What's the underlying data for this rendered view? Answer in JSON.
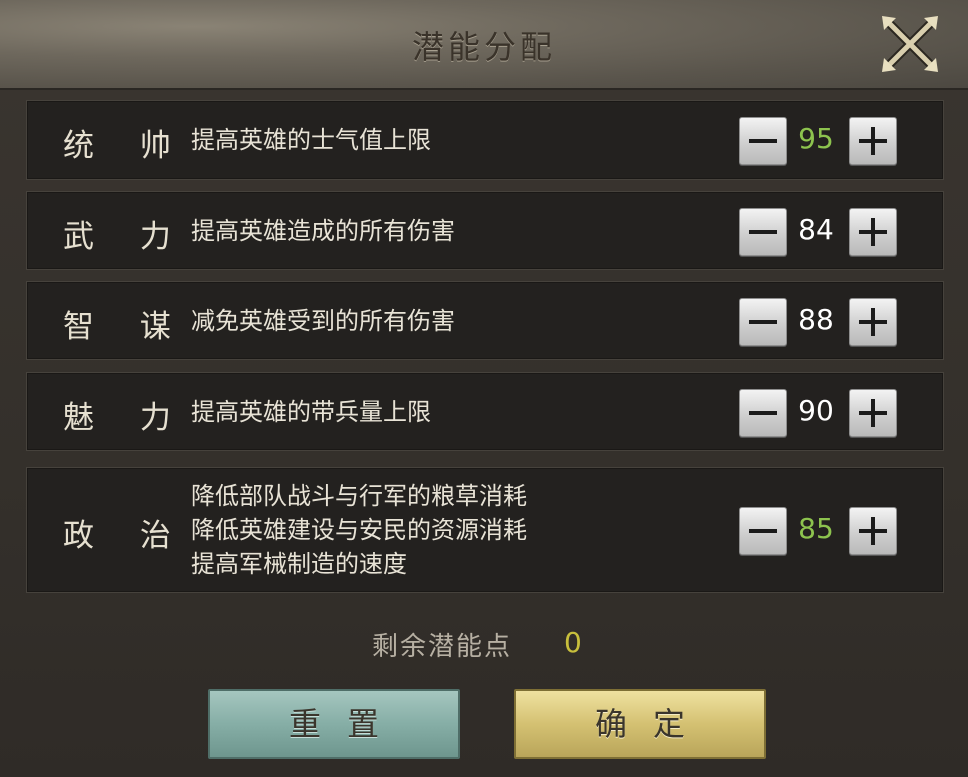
{
  "window": {
    "title": "潜能分配"
  },
  "colors": {
    "value_highlight": "#8dc34e",
    "value_normal": "#ffffff",
    "remaining": "#c8bf3c"
  },
  "attributes": [
    {
      "name": "统 帅",
      "desc": [
        "提高英雄的士气值上限"
      ],
      "value": "95",
      "highlight": true
    },
    {
      "name": "武 力",
      "desc": [
        "提高英雄造成的所有伤害"
      ],
      "value": "84",
      "highlight": false
    },
    {
      "name": "智 谋",
      "desc": [
        "减免英雄受到的所有伤害"
      ],
      "value": "88",
      "highlight": false
    },
    {
      "name": "魅 力",
      "desc": [
        "提高英雄的带兵量上限"
      ],
      "value": "90",
      "highlight": false
    },
    {
      "name": "政 治",
      "desc": [
        "降低部队战斗与行军的粮草消耗",
        "降低英雄建设与安民的资源消耗",
        "提高军械制造的速度"
      ],
      "value": "85",
      "highlight": true
    }
  ],
  "remaining": {
    "label": "剩余潜能点",
    "value": "0"
  },
  "buttons": {
    "reset": "重置",
    "confirm": "确定"
  }
}
